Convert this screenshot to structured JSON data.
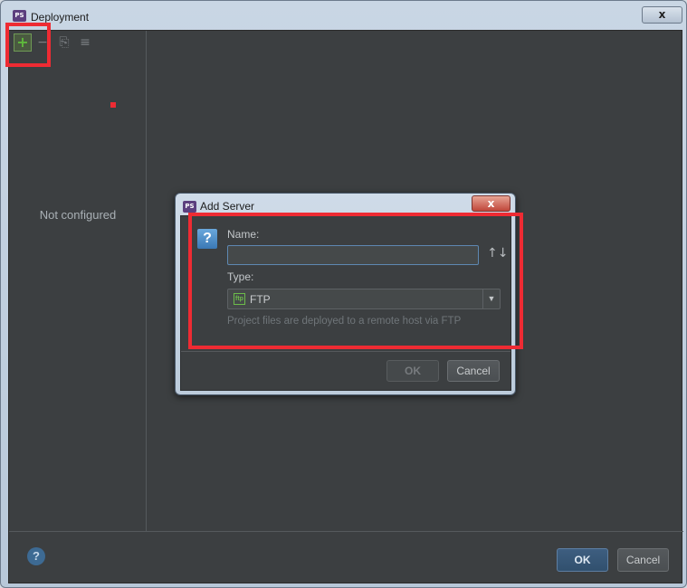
{
  "window": {
    "title": "Deployment",
    "app_badge": "PS",
    "close_glyph": "x"
  },
  "toolbar": {
    "add_glyph": "+",
    "remove_glyph": "−",
    "copy_glyph": "⎘",
    "default_glyph": "≡"
  },
  "left_pane": {
    "empty_text": "Not configured"
  },
  "footer": {
    "help_glyph": "?",
    "ok_label": "OK",
    "cancel_label": "Cancel"
  },
  "dialog": {
    "title": "Add Server",
    "app_badge": "PS",
    "close_glyph": "x",
    "question_glyph": "?",
    "name_label": "Name:",
    "name_value": "",
    "sort_glyph": "↑↓",
    "type_label": "Type:",
    "type_value": "FTP",
    "type_icon_text": "ftp",
    "dropdown_glyph": "▼",
    "hint": "Project files are deployed to a remote host via FTP",
    "ok_label": "OK",
    "cancel_label": "Cancel"
  },
  "colors": {
    "annotation": "#ee2b33",
    "panel_bg": "#3c3f41",
    "accent_green": "#5fb93c"
  }
}
